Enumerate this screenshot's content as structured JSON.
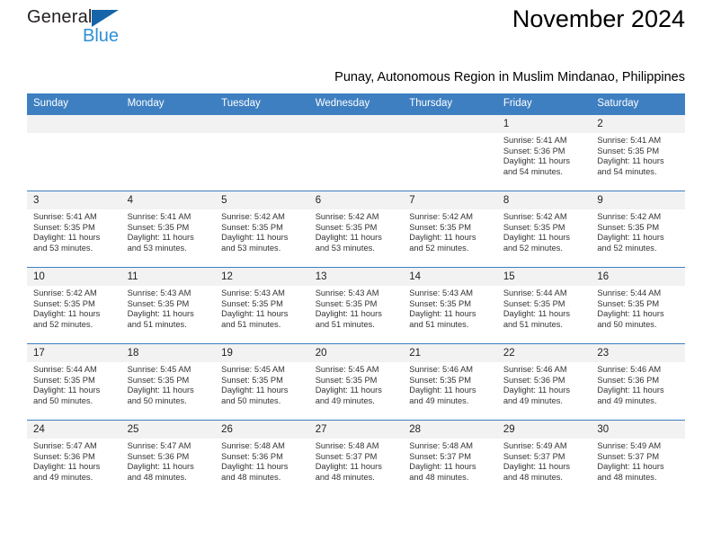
{
  "brand": {
    "name_part1": "General",
    "name_part2": "Blue",
    "triangle_color": "#1565a8",
    "blue_text_color": "#2e8fd6"
  },
  "header": {
    "title": "November 2024",
    "subtitle": "Punay, Autonomous Region in Muslim Mindanao, Philippines"
  },
  "theme": {
    "header_row_bg": "#3e7fc1",
    "daynum_bg": "#f2f2f2",
    "row_border": "#3e7fc1",
    "text": "#333333"
  },
  "weekdays": [
    "Sunday",
    "Monday",
    "Tuesday",
    "Wednesday",
    "Thursday",
    "Friday",
    "Saturday"
  ],
  "weeks": [
    [
      {
        "day": "",
        "sunrise": "",
        "sunset": "",
        "daylight": ""
      },
      {
        "day": "",
        "sunrise": "",
        "sunset": "",
        "daylight": ""
      },
      {
        "day": "",
        "sunrise": "",
        "sunset": "",
        "daylight": ""
      },
      {
        "day": "",
        "sunrise": "",
        "sunset": "",
        "daylight": ""
      },
      {
        "day": "",
        "sunrise": "",
        "sunset": "",
        "daylight": ""
      },
      {
        "day": "1",
        "sunrise": "Sunrise: 5:41 AM",
        "sunset": "Sunset: 5:36 PM",
        "daylight": "Daylight: 11 hours and 54 minutes."
      },
      {
        "day": "2",
        "sunrise": "Sunrise: 5:41 AM",
        "sunset": "Sunset: 5:35 PM",
        "daylight": "Daylight: 11 hours and 54 minutes."
      }
    ],
    [
      {
        "day": "3",
        "sunrise": "Sunrise: 5:41 AM",
        "sunset": "Sunset: 5:35 PM",
        "daylight": "Daylight: 11 hours and 53 minutes."
      },
      {
        "day": "4",
        "sunrise": "Sunrise: 5:41 AM",
        "sunset": "Sunset: 5:35 PM",
        "daylight": "Daylight: 11 hours and 53 minutes."
      },
      {
        "day": "5",
        "sunrise": "Sunrise: 5:42 AM",
        "sunset": "Sunset: 5:35 PM",
        "daylight": "Daylight: 11 hours and 53 minutes."
      },
      {
        "day": "6",
        "sunrise": "Sunrise: 5:42 AM",
        "sunset": "Sunset: 5:35 PM",
        "daylight": "Daylight: 11 hours and 53 minutes."
      },
      {
        "day": "7",
        "sunrise": "Sunrise: 5:42 AM",
        "sunset": "Sunset: 5:35 PM",
        "daylight": "Daylight: 11 hours and 52 minutes."
      },
      {
        "day": "8",
        "sunrise": "Sunrise: 5:42 AM",
        "sunset": "Sunset: 5:35 PM",
        "daylight": "Daylight: 11 hours and 52 minutes."
      },
      {
        "day": "9",
        "sunrise": "Sunrise: 5:42 AM",
        "sunset": "Sunset: 5:35 PM",
        "daylight": "Daylight: 11 hours and 52 minutes."
      }
    ],
    [
      {
        "day": "10",
        "sunrise": "Sunrise: 5:42 AM",
        "sunset": "Sunset: 5:35 PM",
        "daylight": "Daylight: 11 hours and 52 minutes."
      },
      {
        "day": "11",
        "sunrise": "Sunrise: 5:43 AM",
        "sunset": "Sunset: 5:35 PM",
        "daylight": "Daylight: 11 hours and 51 minutes."
      },
      {
        "day": "12",
        "sunrise": "Sunrise: 5:43 AM",
        "sunset": "Sunset: 5:35 PM",
        "daylight": "Daylight: 11 hours and 51 minutes."
      },
      {
        "day": "13",
        "sunrise": "Sunrise: 5:43 AM",
        "sunset": "Sunset: 5:35 PM",
        "daylight": "Daylight: 11 hours and 51 minutes."
      },
      {
        "day": "14",
        "sunrise": "Sunrise: 5:43 AM",
        "sunset": "Sunset: 5:35 PM",
        "daylight": "Daylight: 11 hours and 51 minutes."
      },
      {
        "day": "15",
        "sunrise": "Sunrise: 5:44 AM",
        "sunset": "Sunset: 5:35 PM",
        "daylight": "Daylight: 11 hours and 51 minutes."
      },
      {
        "day": "16",
        "sunrise": "Sunrise: 5:44 AM",
        "sunset": "Sunset: 5:35 PM",
        "daylight": "Daylight: 11 hours and 50 minutes."
      }
    ],
    [
      {
        "day": "17",
        "sunrise": "Sunrise: 5:44 AM",
        "sunset": "Sunset: 5:35 PM",
        "daylight": "Daylight: 11 hours and 50 minutes."
      },
      {
        "day": "18",
        "sunrise": "Sunrise: 5:45 AM",
        "sunset": "Sunset: 5:35 PM",
        "daylight": "Daylight: 11 hours and 50 minutes."
      },
      {
        "day": "19",
        "sunrise": "Sunrise: 5:45 AM",
        "sunset": "Sunset: 5:35 PM",
        "daylight": "Daylight: 11 hours and 50 minutes."
      },
      {
        "day": "20",
        "sunrise": "Sunrise: 5:45 AM",
        "sunset": "Sunset: 5:35 PM",
        "daylight": "Daylight: 11 hours and 49 minutes."
      },
      {
        "day": "21",
        "sunrise": "Sunrise: 5:46 AM",
        "sunset": "Sunset: 5:35 PM",
        "daylight": "Daylight: 11 hours and 49 minutes."
      },
      {
        "day": "22",
        "sunrise": "Sunrise: 5:46 AM",
        "sunset": "Sunset: 5:36 PM",
        "daylight": "Daylight: 11 hours and 49 minutes."
      },
      {
        "day": "23",
        "sunrise": "Sunrise: 5:46 AM",
        "sunset": "Sunset: 5:36 PM",
        "daylight": "Daylight: 11 hours and 49 minutes."
      }
    ],
    [
      {
        "day": "24",
        "sunrise": "Sunrise: 5:47 AM",
        "sunset": "Sunset: 5:36 PM",
        "daylight": "Daylight: 11 hours and 49 minutes."
      },
      {
        "day": "25",
        "sunrise": "Sunrise: 5:47 AM",
        "sunset": "Sunset: 5:36 PM",
        "daylight": "Daylight: 11 hours and 48 minutes."
      },
      {
        "day": "26",
        "sunrise": "Sunrise: 5:48 AM",
        "sunset": "Sunset: 5:36 PM",
        "daylight": "Daylight: 11 hours and 48 minutes."
      },
      {
        "day": "27",
        "sunrise": "Sunrise: 5:48 AM",
        "sunset": "Sunset: 5:37 PM",
        "daylight": "Daylight: 11 hours and 48 minutes."
      },
      {
        "day": "28",
        "sunrise": "Sunrise: 5:48 AM",
        "sunset": "Sunset: 5:37 PM",
        "daylight": "Daylight: 11 hours and 48 minutes."
      },
      {
        "day": "29",
        "sunrise": "Sunrise: 5:49 AM",
        "sunset": "Sunset: 5:37 PM",
        "daylight": "Daylight: 11 hours and 48 minutes."
      },
      {
        "day": "30",
        "sunrise": "Sunrise: 5:49 AM",
        "sunset": "Sunset: 5:37 PM",
        "daylight": "Daylight: 11 hours and 48 minutes."
      }
    ]
  ]
}
